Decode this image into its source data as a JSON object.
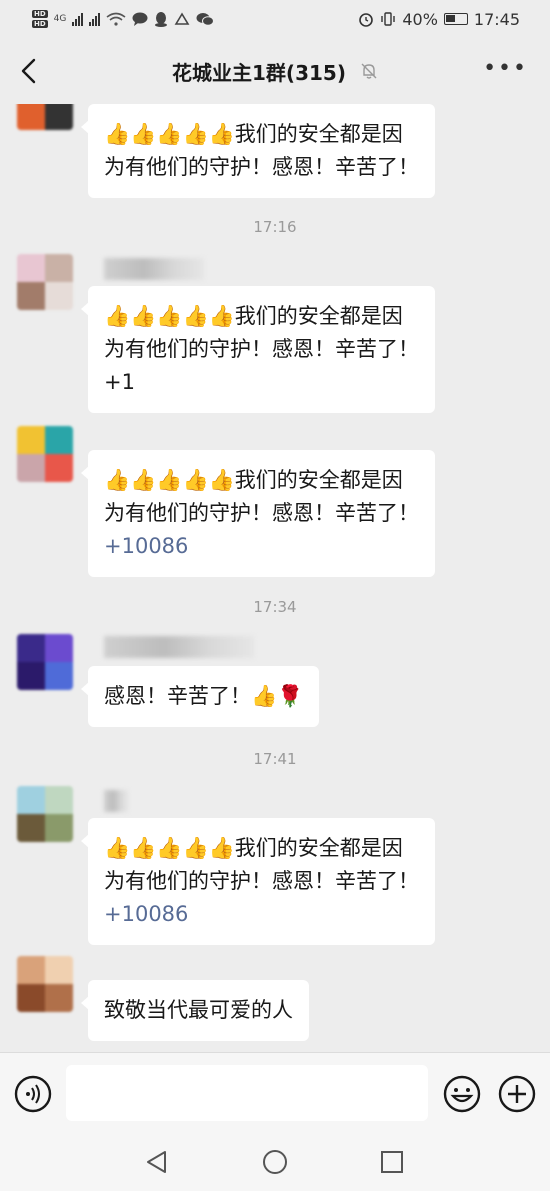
{
  "status_bar": {
    "left_labels": [
      "HD",
      "HD"
    ],
    "network": "4G",
    "battery": "40%",
    "time": "17:45"
  },
  "header": {
    "title": "花城业主1群(315)",
    "icons": [
      "back-arrow-icon",
      "mute-bell-icon",
      "more-icon"
    ]
  },
  "messages": [
    {
      "type": "message",
      "lines": [
        "👍👍👍👍👍我们的安全都是因",
        "为有他们的守护！感恩！辛苦了！"
      ]
    },
    {
      "type": "time",
      "text": "17:16"
    },
    {
      "type": "message",
      "lines": [
        "👍👍👍👍👍我们的安全都是因",
        "为有他们的守护！感恩！辛苦了！",
        "+1"
      ]
    },
    {
      "type": "message",
      "lines": [
        "👍👍👍👍👍我们的安全都是因",
        "为有他们的守护！感恩！辛苦了！",
        "+10086"
      ]
    },
    {
      "type": "time",
      "text": "17:34"
    },
    {
      "type": "message",
      "lines": [
        "感恩！辛苦了！👍🌹"
      ]
    },
    {
      "type": "time",
      "text": "17:41"
    },
    {
      "type": "message",
      "lines": [
        "👍👍👍👍👍我们的安全都是因",
        "为有他们的守护！感恩！辛苦了！",
        "+10086"
      ]
    },
    {
      "type": "message",
      "lines": [
        "致敬当代最可爱的人"
      ]
    }
  ],
  "input": {
    "value": "",
    "icons": [
      "voice-icon",
      "emoji-icon",
      "plus-icon"
    ]
  },
  "navbar": {
    "icons": [
      "nav-back-icon",
      "nav-home-icon",
      "nav-recents-icon"
    ]
  },
  "colors": {
    "background": "#ededed",
    "bubble": "#ffffff",
    "link_blue": "#576b95",
    "time_gray": "#9a9a9a"
  }
}
